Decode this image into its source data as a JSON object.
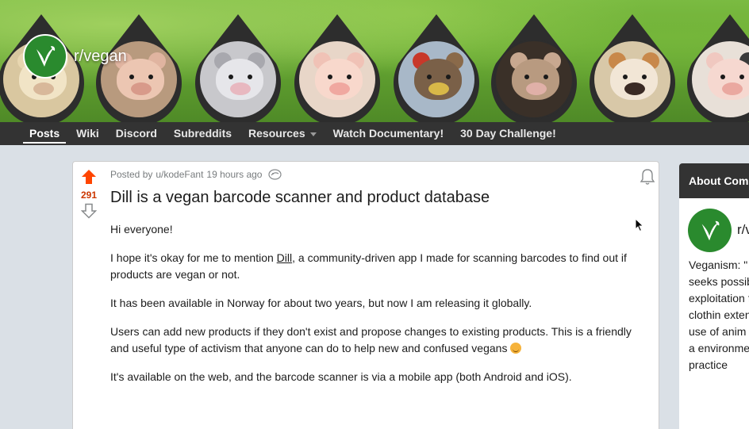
{
  "subreddit": {
    "name": "r/vegan"
  },
  "nav": {
    "items": [
      {
        "label": "Posts",
        "active": true
      },
      {
        "label": "Wiki"
      },
      {
        "label": "Discord"
      },
      {
        "label": "Subreddits"
      },
      {
        "label": "Resources",
        "dropdown": true
      },
      {
        "label": "Watch Documentary!"
      },
      {
        "label": "30 Day Challenge!"
      }
    ]
  },
  "post": {
    "score": "291",
    "meta_prefix": "Posted by",
    "author": "u/kodeFant",
    "time": "19 hours ago",
    "title": "Dill is a vegan barcode scanner and product database",
    "body": {
      "p1": "Hi everyone!",
      "p2_before": "I hope it's okay for me to mention ",
      "p2_link": "Dill",
      "p2_after": ", a community-driven app I made for scanning barcodes to find out if products are vegan or not.",
      "p3": "It has been available in Norway for about two years, but now I am releasing it globally.",
      "p4": "Users can add new products if they don't exist and propose changes to existing products. This is a friendly and useful type of activism that anyone can do to help new and confused vegans ",
      "p5": "It's available on the web, and the barcode scanner is via a mobile app (both Android and iOS)."
    }
  },
  "sidebar": {
    "about_title": "About Com",
    "community_name": "r/v",
    "description": "Veganism: \" which seeks possible and exploitation food, clothin extension, p use of anim benefit of a environmer the practice"
  },
  "colors": {
    "upvote": "#ff4500",
    "score": "#cc3700",
    "nav_bg": "#333333",
    "logo_green": "#2a8a2e",
    "page_bg": "#dae0e6"
  },
  "icons": {
    "upvote": "arrow-up-icon",
    "downvote": "arrow-down-icon",
    "award": "award-icon",
    "bell": "bell-icon",
    "logo": "leaf-v-icon"
  }
}
